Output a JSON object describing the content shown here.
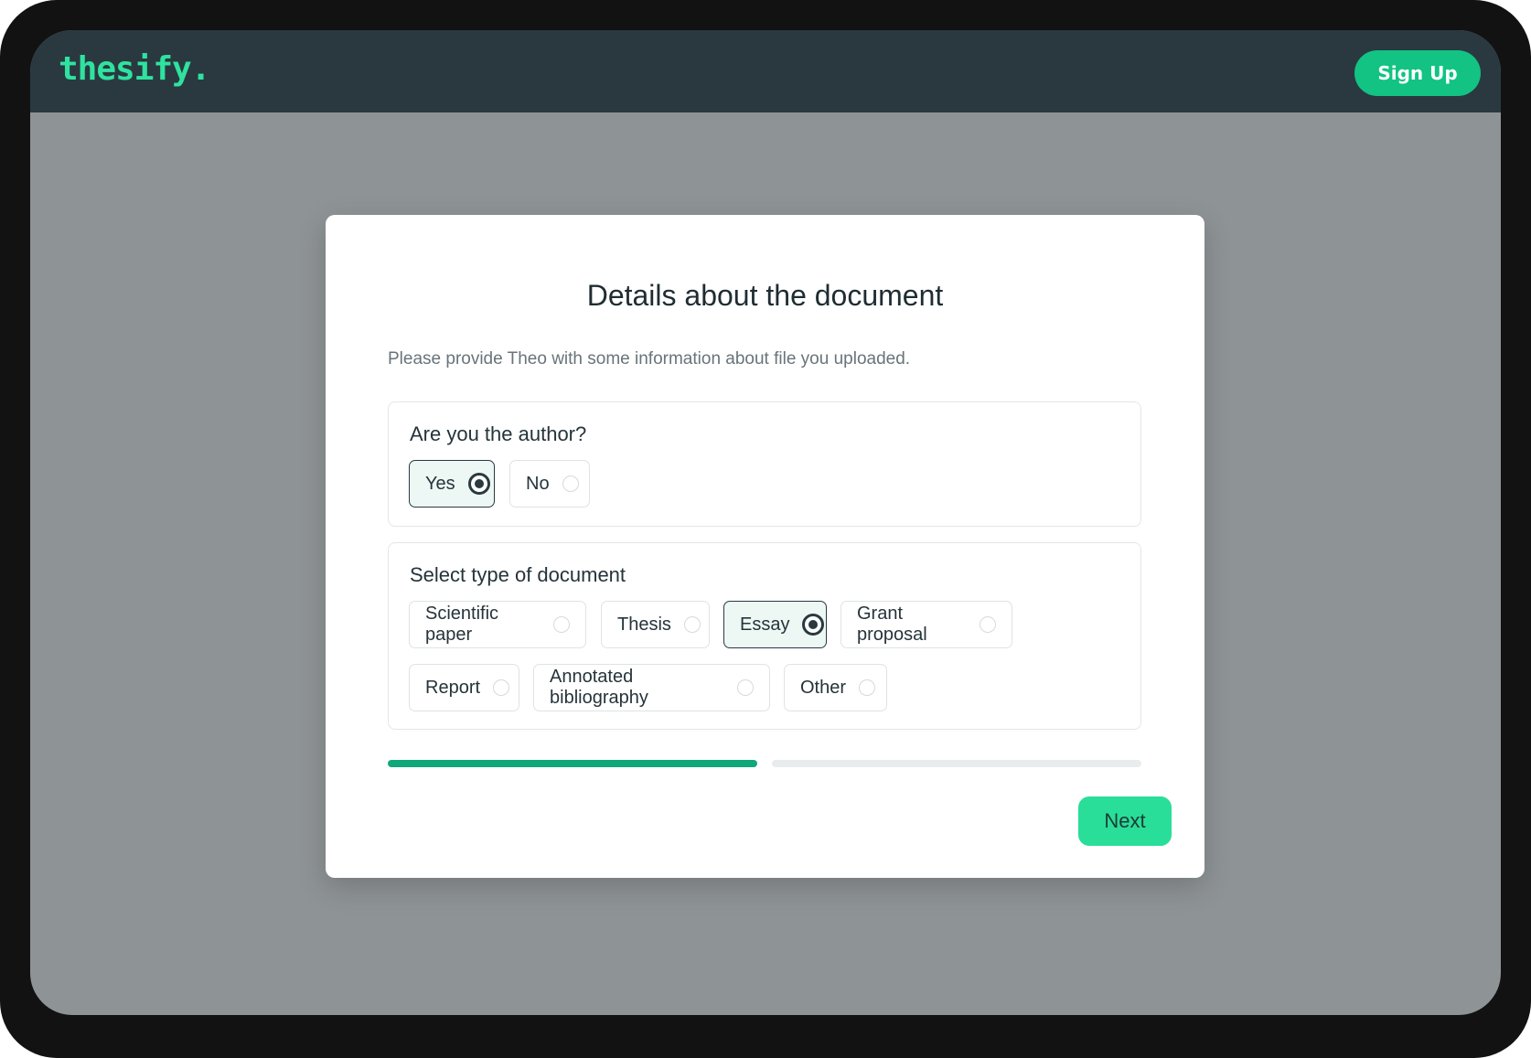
{
  "brand": {
    "logo": "thesify."
  },
  "topbar": {
    "signup_label": "Sign Up"
  },
  "modal": {
    "title": "Details about the document",
    "description": "Please provide Theo with some information about file you uploaded.",
    "author_section": {
      "label": "Are you the author?",
      "options": [
        {
          "label": "Yes",
          "selected": true
        },
        {
          "label": "No",
          "selected": false
        }
      ]
    },
    "type_section": {
      "label": "Select type of document",
      "options": [
        {
          "label": "Scientific paper",
          "selected": false
        },
        {
          "label": "Thesis",
          "selected": false
        },
        {
          "label": "Essay",
          "selected": true
        },
        {
          "label": "Grant proposal",
          "selected": false
        },
        {
          "label": "Report",
          "selected": false
        },
        {
          "label": "Annotated bibliography",
          "selected": false
        },
        {
          "label": "Other",
          "selected": false
        }
      ]
    },
    "progress": {
      "current_step": 1,
      "total_steps": 2
    },
    "next_label": "Next"
  },
  "colors": {
    "brand_green": "#2fe29f",
    "accent": "#12c383",
    "topbar": "#2a3940",
    "overlay": "#8e9396",
    "next_button": "#29de99",
    "progress_done": "#12a77a"
  }
}
